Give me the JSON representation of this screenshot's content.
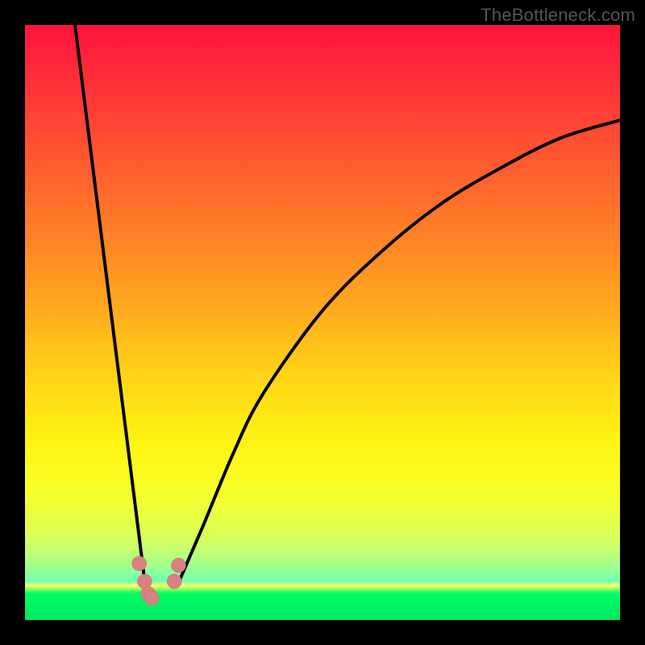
{
  "watermark": "TheBottleneck.com",
  "colors": {
    "marker": "#d98080",
    "curve": "#000000",
    "frame": "#000000"
  },
  "chart_data": {
    "type": "line",
    "title": "",
    "xlabel": "",
    "ylabel": "",
    "note": "Bottleneck V-curve with heatmap gradient background. Values are estimated from pixel positions; the image has no numeric axes.",
    "x_range_fraction": [
      0,
      1
    ],
    "y_range_bottleneck_pct": [
      0,
      100
    ],
    "series": [
      {
        "name": "left-branch",
        "x_fraction": [
          0.084,
          0.203
        ],
        "y_bottleneck_pct": [
          100,
          5.1
        ]
      },
      {
        "name": "right-branch",
        "x_fraction": [
          0.256,
          0.3,
          0.35,
          0.4,
          0.5,
          0.6,
          0.7,
          0.8,
          0.9,
          1.0
        ],
        "y_bottleneck_pct": [
          5.8,
          16,
          28,
          38,
          52,
          62,
          70,
          76,
          81,
          84
        ]
      }
    ],
    "markers": [
      {
        "x_fraction": 0.192,
        "y_bottleneck_pct": 9.5
      },
      {
        "x_fraction": 0.201,
        "y_bottleneck_pct": 6.5
      },
      {
        "x_fraction": 0.207,
        "y_bottleneck_pct": 4.4
      },
      {
        "x_fraction": 0.213,
        "y_bottleneck_pct": 3.7
      },
      {
        "x_fraction": 0.251,
        "y_bottleneck_pct": 6.5
      },
      {
        "x_fraction": 0.258,
        "y_bottleneck_pct": 9.2
      }
    ],
    "marker_radius_px": 9,
    "gradient": {
      "top_color": "#ff143c",
      "bottom_color": "#00e860",
      "meaning": "top=high bottleneck, bottom=low bottleneck"
    }
  }
}
